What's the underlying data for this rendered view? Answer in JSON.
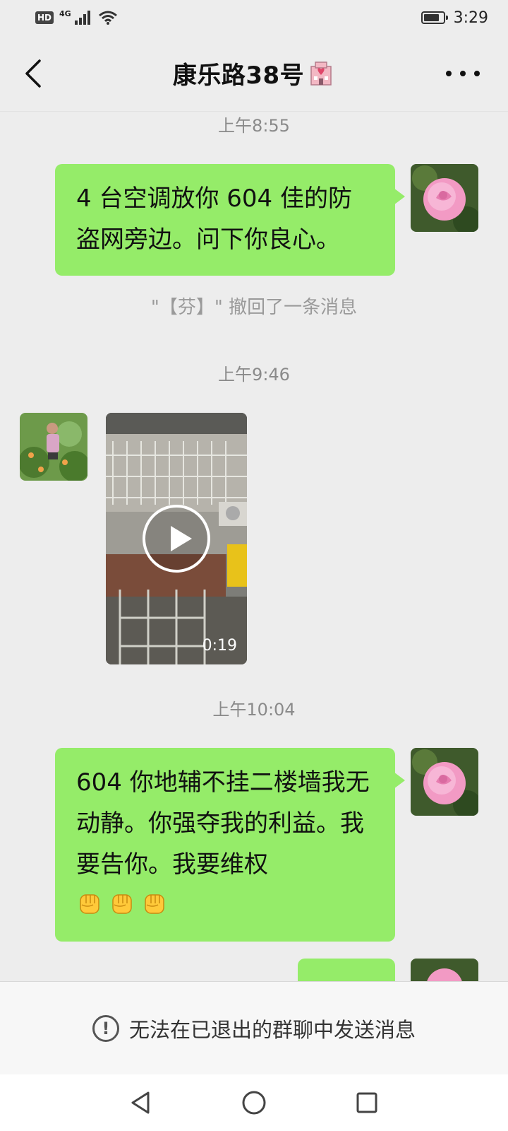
{
  "status_bar": {
    "hd": "HD",
    "network": "4G",
    "time": "3:29",
    "battery_level": 0.75
  },
  "header": {
    "title": "康乐路38号",
    "title_emoji": "hospital-icon"
  },
  "messages": [
    {
      "type": "timestamp",
      "text": "上午8:55"
    },
    {
      "type": "text",
      "side": "right",
      "text": "4 台空调放你 604 佳的防盗网旁边。问下你良心。"
    },
    {
      "type": "system",
      "text": "\"【芬】\" 撤回了一条消息"
    },
    {
      "type": "timestamp",
      "text": "上午9:46"
    },
    {
      "type": "video",
      "side": "left",
      "duration": "0:19"
    },
    {
      "type": "timestamp",
      "text": "上午10:04"
    },
    {
      "type": "text",
      "side": "right",
      "text": "604 你地辅不挂二楼墙我无动静。你强夺我的利益。我要告你。我要维权",
      "emojis": [
        "fist-icon",
        "fist-icon",
        "fist-icon"
      ]
    }
  ],
  "input_bar": {
    "notice": "无法在已退出的群聊中发送消息"
  },
  "colors": {
    "bubble_green": "#95ec69",
    "background": "#ededed"
  }
}
